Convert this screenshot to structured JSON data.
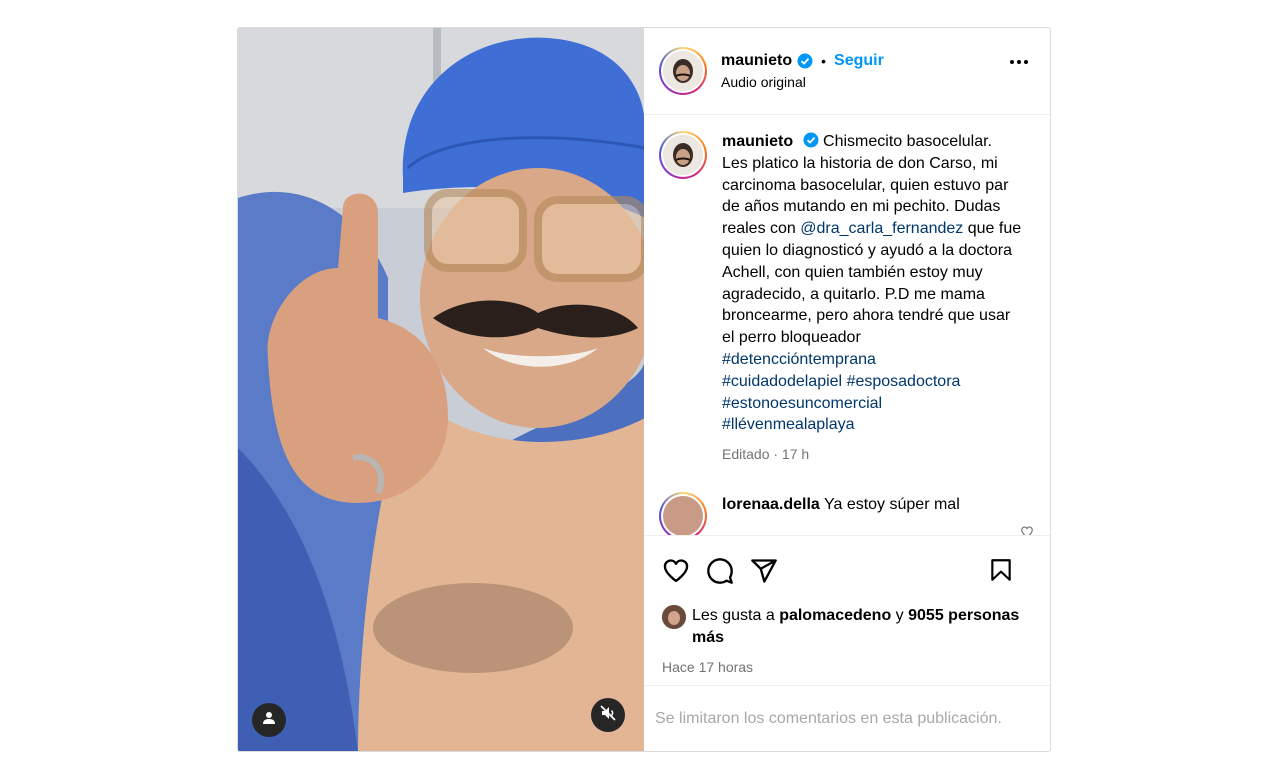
{
  "post": {
    "author": {
      "username": "maunieto",
      "verified": true,
      "follow_label": "Seguir",
      "audio_label": "Audio original"
    },
    "caption": {
      "username": "maunieto",
      "text": "Chismecito basocelular. Les platico la historia de don Carso, mi carcinoma basocelular, quien estuvo par de años mutando en mi pechito. Dudas reales con",
      "mention": "@dra_carla_fernandez",
      "text2": "que fue quien lo diagnosticó y ayudó a la doctora Achell, con quien también estoy muy agradecido, a quitarlo. P.D me mama broncearme, pero ahora tendré que usar el perro bloqueador",
      "hashtags": [
        "#detenccióntemprana",
        "#cuidadodelapiel",
        "#esposadoctora",
        "#estonoesuncomercial",
        "#llévenmealaplaya"
      ],
      "meta": "Editado · 17 h"
    },
    "comment": {
      "username": "lorenaa.della",
      "text": "Ya estoy súper mal"
    },
    "likes": {
      "prefix": "Les gusta a",
      "liker": "palomacedeno",
      "connector": "y",
      "count_text": "9055 personas más"
    },
    "time": "Hace 17 horas",
    "comments_limited": "Se limitaron los comentarios en esta publicación.",
    "icons": {
      "like": "heart-icon",
      "comment": "comment-icon",
      "share": "share-icon",
      "save": "bookmark-icon",
      "more": "more-options-icon",
      "mute": "muted-speaker-icon",
      "tagged": "user-tag-icon"
    },
    "colors": {
      "link_blue": "#0095f6",
      "hashtag": "#00376b",
      "verified": "#0095f6",
      "secondary_text": "#737373"
    }
  }
}
